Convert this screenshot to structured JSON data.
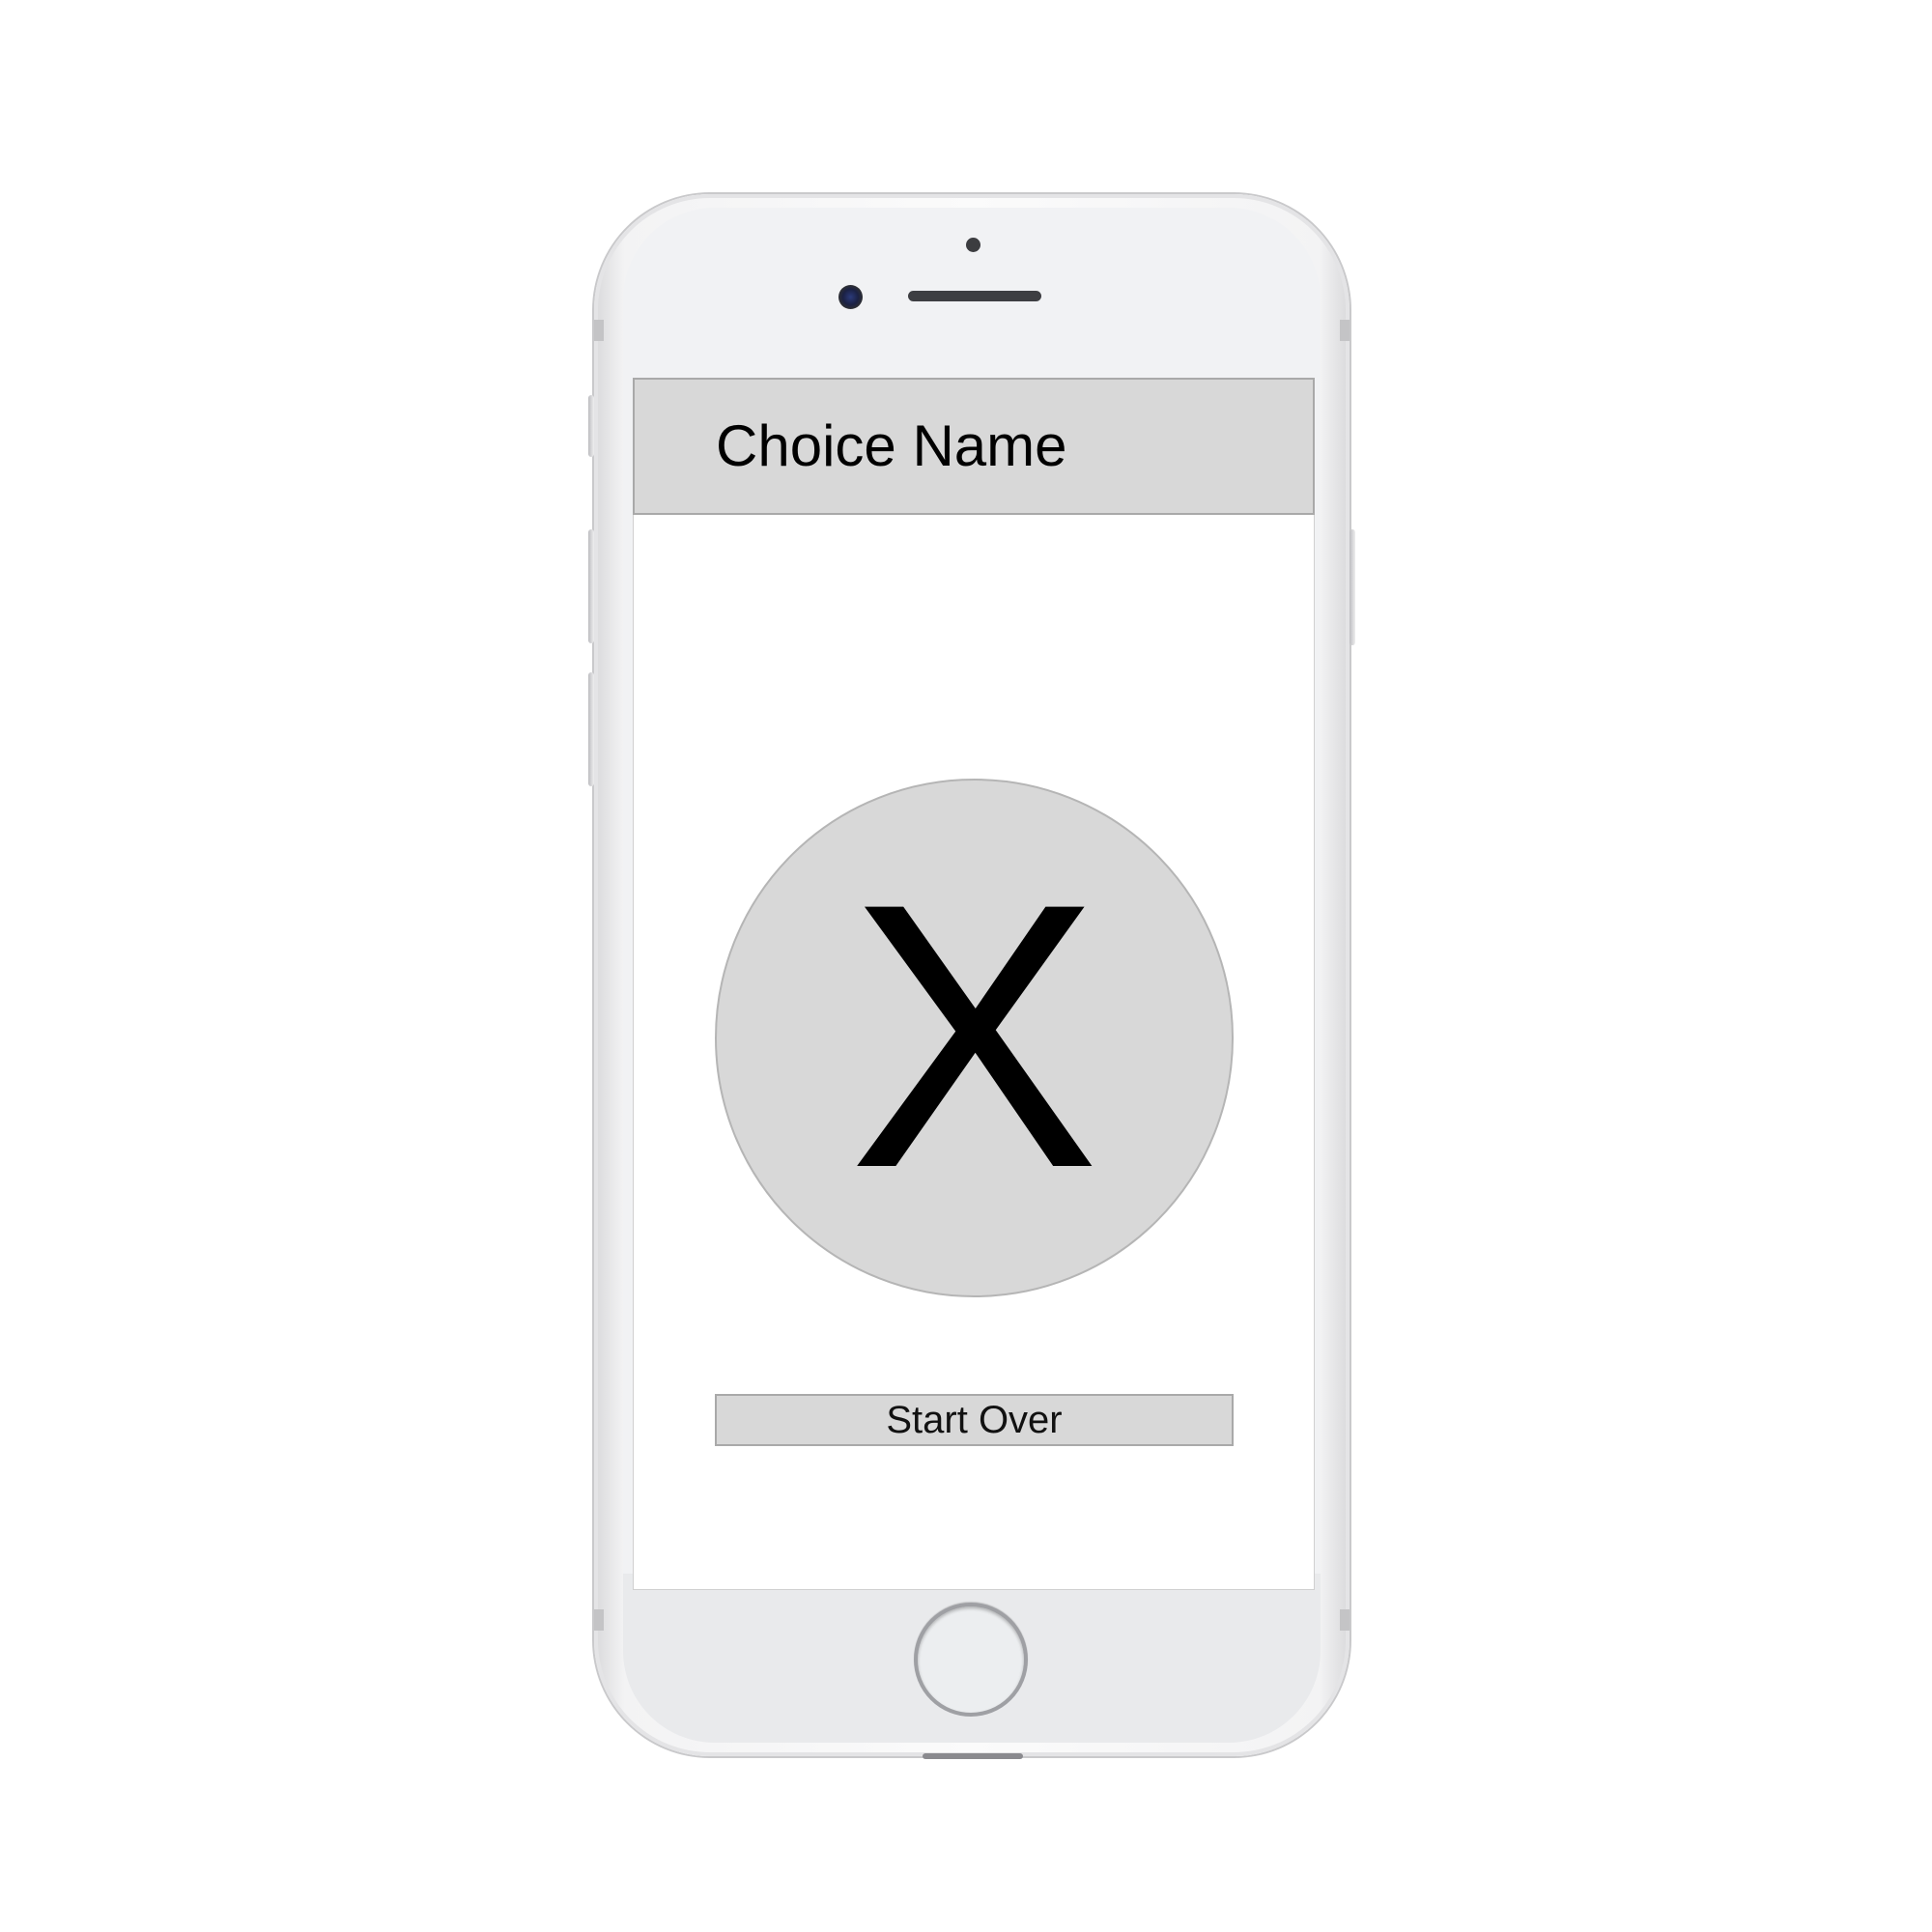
{
  "header": {
    "title": "Choice Name"
  },
  "result": {
    "mark": "X"
  },
  "actions": {
    "start_over_label": "Start Over"
  },
  "colors": {
    "panel_fill": "#d8d8d8",
    "panel_border": "#a9a9a9",
    "text": "#000000",
    "device_body": "#f1f2f4"
  }
}
